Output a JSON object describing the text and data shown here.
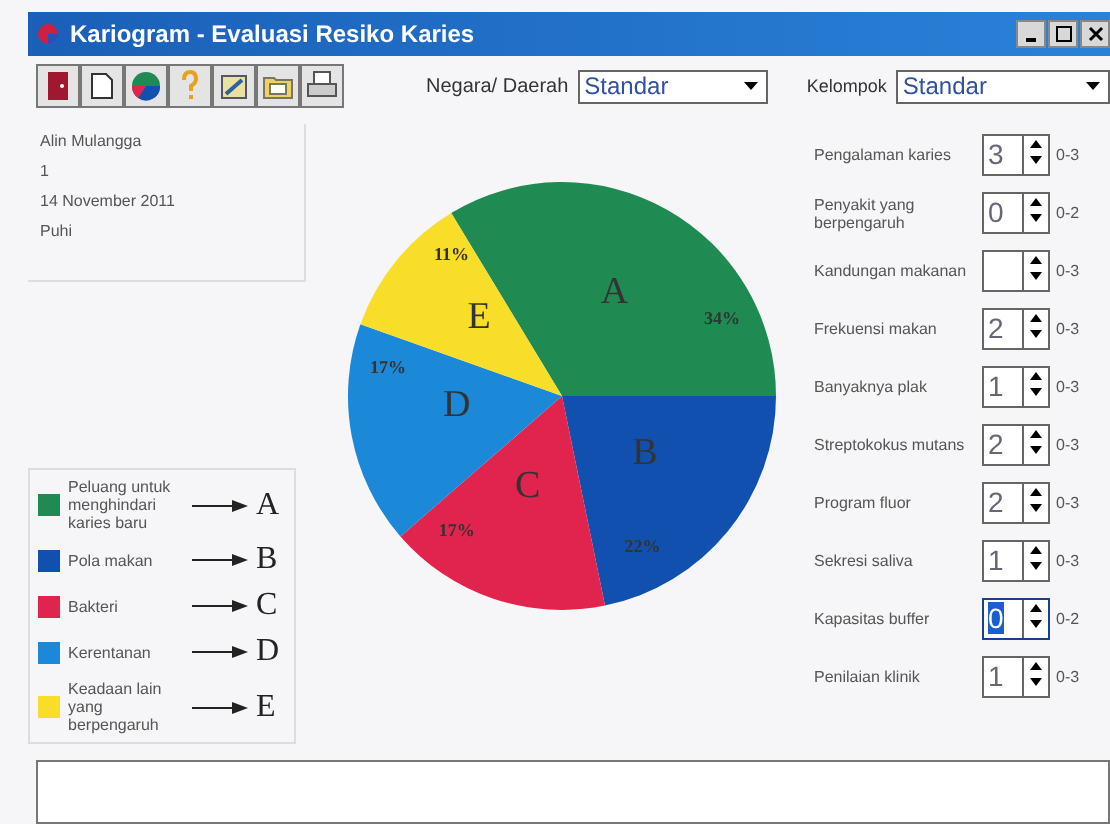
{
  "window": {
    "title": "Kariogram - Evaluasi Resiko Karies"
  },
  "toolbar": {
    "region_label": "Negara/ Daerah",
    "region_value": "Standar",
    "group_label": "Kelompok",
    "group_value": "Standar"
  },
  "patient": [
    "Alin Mulangga",
    "1",
    "14 November 2011",
    "Puhi"
  ],
  "chart": {
    "chart_data": {
      "type": "pie",
      "categories": [
        "A",
        "B",
        "C",
        "D",
        "E"
      ],
      "values": [
        34,
        22,
        17,
        17,
        11
      ],
      "colors": [
        "#1f8a52",
        "#1250b0",
        "#e0244e",
        "#1c88d8",
        "#f8de28"
      ],
      "value_labels": [
        "34%",
        "22%",
        "17%",
        "17%",
        "11%"
      ]
    }
  },
  "legend": [
    {
      "label": "Peluang untuk menghindari karies baru",
      "color": "#1f8a52",
      "letter": "A"
    },
    {
      "label": "Pola makan",
      "color": "#1250b0",
      "letter": "B"
    },
    {
      "label": "Bakteri",
      "color": "#e0244e",
      "letter": "C"
    },
    {
      "label": "Kerentanan",
      "color": "#1c88d8",
      "letter": "D"
    },
    {
      "label": "Keadaan lain yang berpengaruh",
      "color": "#f8de28",
      "letter": "E"
    }
  ],
  "factors": [
    {
      "label": "Pengalaman karies",
      "value": "3",
      "range": "0-3",
      "selected": false
    },
    {
      "label": "Penyakit yang berpengaruh",
      "value": "0",
      "range": "0-2",
      "selected": false
    },
    {
      "label": "Kandungan makanan",
      "range": "0-3",
      "selected": false
    },
    {
      "label": "Frekuensi makan",
      "value": "2",
      "range": "0-3",
      "selected": false
    },
    {
      "label": "Banyaknya plak",
      "value": "1",
      "range": "0-3",
      "selected": false
    },
    {
      "label": "Streptokokus mutans",
      "value": "2",
      "range": "0-3",
      "selected": false
    },
    {
      "label": "Program fluor",
      "value": "2",
      "range": "0-3",
      "selected": false
    },
    {
      "label": "Sekresi saliva",
      "value": "1",
      "range": "0-3",
      "selected": false
    },
    {
      "label": "Kapasitas buffer",
      "value": "0",
      "range": "0-2",
      "selected": true
    },
    {
      "label": "Penilaian klinik",
      "value": "1",
      "range": "0-3",
      "selected": false
    }
  ]
}
